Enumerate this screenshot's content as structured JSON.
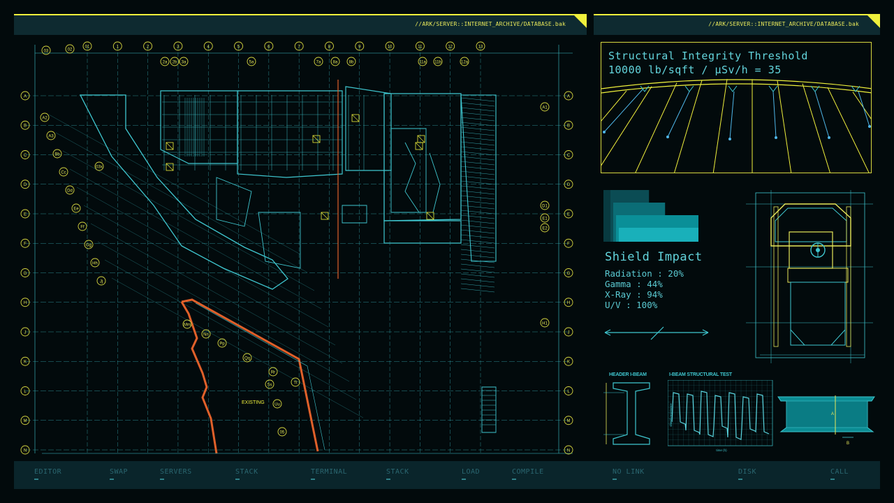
{
  "headers": {
    "left_path": "//ARK/SERVER::INTERNET_ARCHIVE/DATABASE.bak",
    "right_path": "//ARK/SERVER::INTERNET_ARCHIVE/DATABASE.bak"
  },
  "blueprint": {
    "top_columns": [
      "01",
      "1",
      "2",
      "3",
      "4",
      "5",
      "6",
      "7",
      "8",
      "9",
      "10",
      "11",
      "12",
      "13"
    ],
    "left_rows": [
      "A",
      "B",
      "C",
      "D",
      "E",
      "F",
      "G",
      "H",
      "J",
      "K",
      "L",
      "M",
      "N"
    ],
    "diagonal_labels": [
      "A2",
      "A3",
      "Bb",
      "Cc",
      "Dd",
      "Ee",
      "Ff",
      "Gg",
      "Hh",
      "Jj"
    ],
    "right_extra_labels": [
      "A1",
      "D1",
      "E1",
      "E2",
      "H1"
    ],
    "top_small_labels": [
      "03",
      "02",
      "2a",
      "2b",
      "3a",
      "5a",
      "7a",
      "8a",
      "8b",
      "11a",
      "11b",
      "12a"
    ],
    "lower_labels": [
      "Mm",
      "Nn",
      "Pp",
      "Qq",
      "Rr",
      "Ss",
      "Tt",
      "Uu",
      "05"
    ],
    "existing_label": "EXISTING",
    "small_label": "03x"
  },
  "integrity": {
    "title": "Structural Integrity Threshold",
    "formula": "10000 lb/sqft / µSv/h = 35"
  },
  "shield": {
    "title": "Shield Impact",
    "lines": [
      "Radiation : 20%",
      "Gamma : 44%",
      "X-Ray : 94%",
      "U/V : 100%"
    ],
    "levels": [
      20,
      44,
      94,
      100
    ]
  },
  "beams": {
    "header_label": "HEADER I-BEAM",
    "test_label": "I-BEAM STRUCTURAL TEST",
    "test_ylabel": "shield resistance",
    "test_xlabel": "time (h)",
    "dim_a": "A",
    "dim_b": "B"
  },
  "taskbar": {
    "items": [
      "EDITOR",
      "SWAP",
      "SERVERS",
      "STACK",
      "TERMINAL",
      "STACK",
      "LOAD",
      "COMPILE",
      "NO LINK",
      "DISK",
      "CALL"
    ]
  },
  "colors": {
    "cyan": "#3fc6cf",
    "yellow": "#f0f03c",
    "orange": "#e0602a",
    "panel": "#0e2a30"
  }
}
